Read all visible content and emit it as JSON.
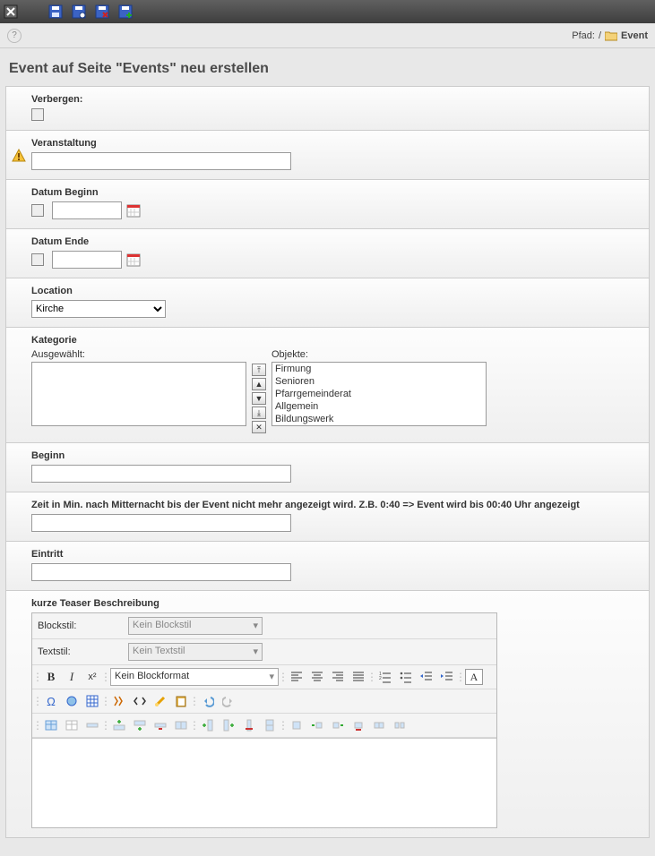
{
  "path": {
    "label": "Pfad:",
    "root": "/",
    "page": "Event"
  },
  "page_title": "Event auf Seite \"Events\" neu erstellen",
  "fields": {
    "hide_label": "Verbergen:",
    "title_label": "Veranstaltung",
    "date_start_label": "Datum Beginn",
    "date_end_label": "Datum Ende",
    "location_label": "Location",
    "location_value": "Kirche",
    "category_label": "Kategorie",
    "selected_label": "Ausgewählt:",
    "objects_label": "Objekte:",
    "category_options": [
      "Firmung",
      "Senioren",
      "Pfarrgemeinderat",
      "Allgemein",
      "Bildungswerk"
    ],
    "begin_label": "Beginn",
    "midnight_label": "Zeit in Min. nach Mitternacht bis der Event nicht mehr angezeigt wird. Z.B. 0:40 => Event wird bis 00:40 Uhr angezeigt",
    "entry_label": "Eintritt",
    "teaser_label": "kurze Teaser Beschreibung"
  },
  "rte": {
    "blockstyle_label": "Blockstil:",
    "blockstyle_placeholder": "Kein Blockstil",
    "textstyle_label": "Textstil:",
    "textstyle_placeholder": "Kein Textstil",
    "blockformat_value": "Kein Blockformat",
    "a_box": "A"
  }
}
